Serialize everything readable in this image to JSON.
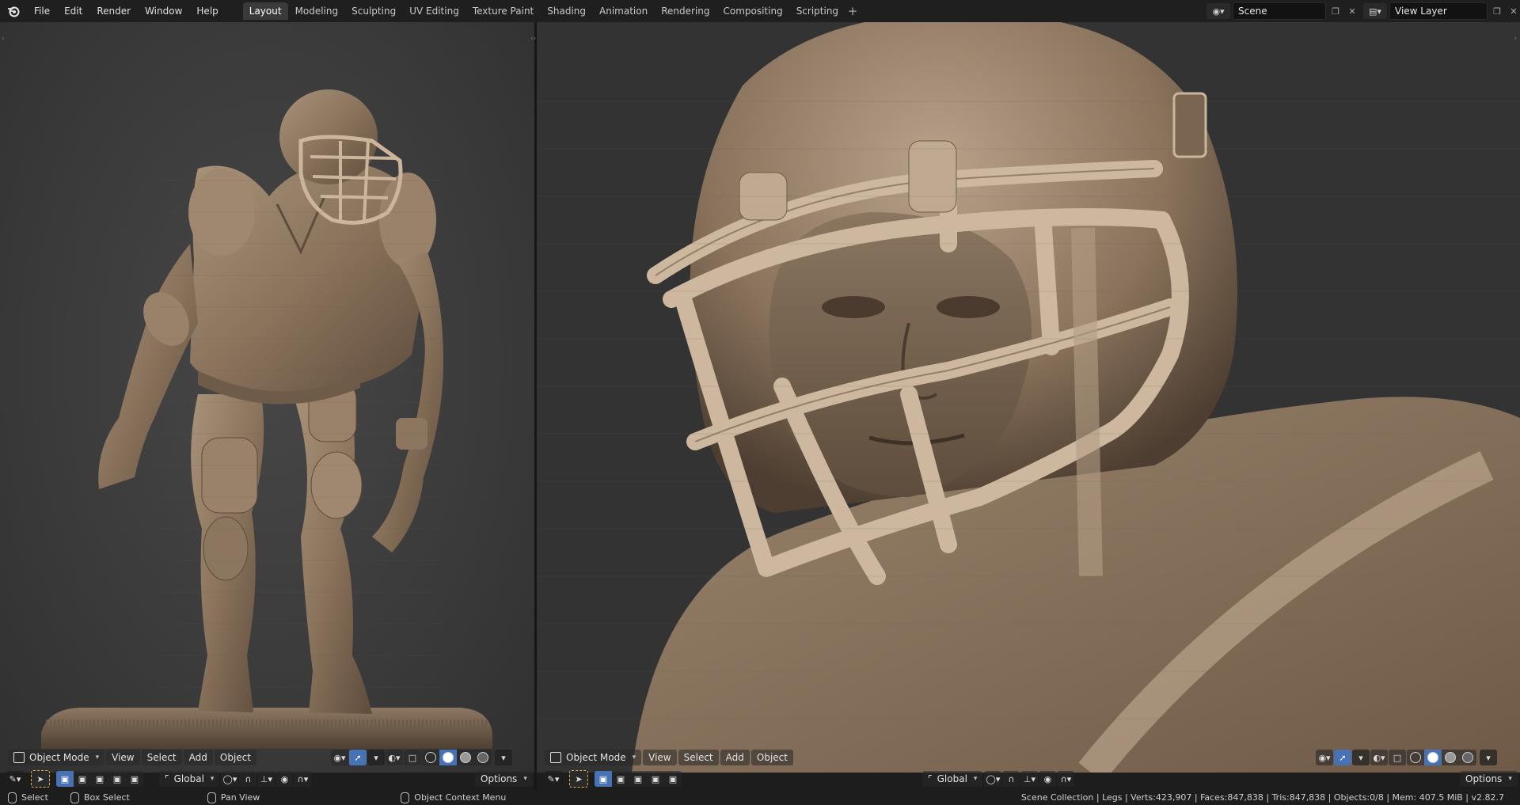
{
  "menubar": {
    "items": [
      "File",
      "Edit",
      "Render",
      "Window",
      "Help"
    ]
  },
  "workspaces": {
    "tabs": [
      "Layout",
      "Modeling",
      "Sculpting",
      "UV Editing",
      "Texture Paint",
      "Shading",
      "Animation",
      "Rendering",
      "Compositing",
      "Scripting"
    ],
    "active": "Layout",
    "add_label": "+"
  },
  "scene": {
    "name": "Scene",
    "view_layer": "View Layer"
  },
  "viewport_left": {
    "mode": "Object Mode",
    "menus": [
      "View",
      "Select",
      "Add",
      "Object"
    ],
    "orientation": "Global",
    "options_label": "Options"
  },
  "viewport_right": {
    "mode": "Object Mode",
    "menus": [
      "View",
      "Select",
      "Add",
      "Object"
    ],
    "orientation": "Global",
    "options_label": "Options"
  },
  "statusbar": {
    "select": "Select",
    "box_select": "Box Select",
    "pan_view": "Pan View",
    "context_menu": "Object Context Menu",
    "stats": "Scene Collection | Legs | Verts:423,907 | Faces:847,838 | Tris:847,838 | Objects:0/8 | Mem: 407.5 MiB | v2.82.7"
  },
  "icons": {
    "logo": "blender-logo-icon",
    "accent": "#4772b3",
    "model_color": "#8c7660"
  }
}
